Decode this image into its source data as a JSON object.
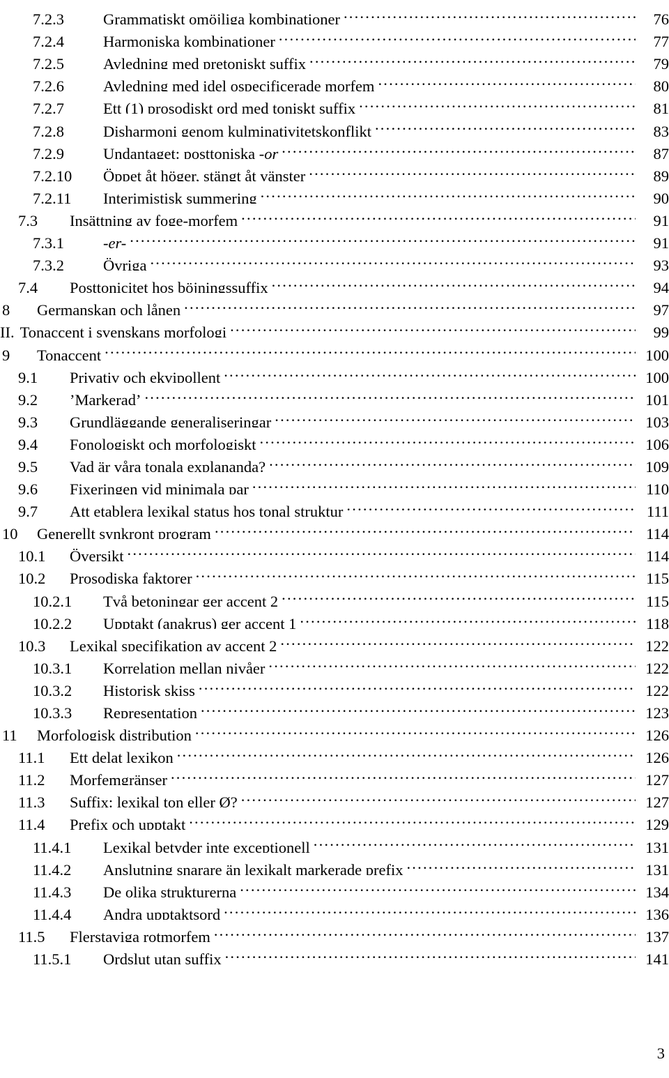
{
  "document": {
    "footer_page_number": "3"
  },
  "toc": {
    "entries": [
      {
        "number": "7.2.3",
        "title": "Grammatiskt omöjliga kombinationer",
        "page": "76",
        "level": 3
      },
      {
        "number": "7.2.4",
        "title": "Harmoniska kombinationer",
        "page": "77",
        "level": 3
      },
      {
        "number": "7.2.5",
        "title": "Avledning med pretoniskt suffix",
        "page": "79",
        "level": 3
      },
      {
        "number": "7.2.6",
        "title": "Avledning med idel ospecificerade morfem",
        "page": "80",
        "level": 3
      },
      {
        "number": "7.2.7",
        "title": "Ett (1) prosodiskt ord med toniskt suffix",
        "page": "81",
        "level": 3
      },
      {
        "number": "7.2.8",
        "title": "Disharmoni genom kulminativitetskonflikt",
        "page": "83",
        "level": 3
      },
      {
        "number": "7.2.9",
        "title": "Undantaget: posttoniska -or",
        "page": "87",
        "level": 3,
        "italic_tail": "-or",
        "title_head": "Undantaget: posttoniska "
      },
      {
        "number": "7.2.10",
        "title": "Öppet åt höger, stängt åt vänster",
        "page": "89",
        "level": 3
      },
      {
        "number": "7.2.11",
        "title": "Interimistisk summering",
        "page": "90",
        "level": 3
      },
      {
        "number": "7.3",
        "title": "Insättning av foge-morfem",
        "page": "91",
        "level": 2
      },
      {
        "number": "7.3.1",
        "title": "-er-",
        "page": "91",
        "level": 3,
        "italic_tail": "-er-",
        "title_head": ""
      },
      {
        "number": "7.3.2",
        "title": "Övriga",
        "page": "93",
        "level": 3
      },
      {
        "number": "7.4",
        "title": "Posttonicitet hos böjningssuffix",
        "page": "94",
        "level": 2
      },
      {
        "number": "8",
        "title": "Germanskan och lånen",
        "page": "97",
        "level": 1
      },
      {
        "number": "II.",
        "title": "Tonaccent i svenskans morfologi",
        "page": "99",
        "level": 0
      },
      {
        "number": "9",
        "title": "Tonaccent",
        "page": "100",
        "level": 1
      },
      {
        "number": "9.1",
        "title": "Privativ och ekvipollent",
        "page": "100",
        "level": 2
      },
      {
        "number": "9.2",
        "title": "’Markerad’",
        "page": "101",
        "level": 2
      },
      {
        "number": "9.3",
        "title": "Grundläggande generaliseringar",
        "page": "103",
        "level": 2
      },
      {
        "number": "9.4",
        "title": "Fonologiskt och morfologiskt",
        "page": "106",
        "level": 2
      },
      {
        "number": "9.5",
        "title": "Vad är våra tonala explananda?",
        "page": "109",
        "level": 2
      },
      {
        "number": "9.6",
        "title": "Fixeringen vid minimala par",
        "page": "110",
        "level": 2
      },
      {
        "number": "9.7",
        "title": "Att etablera lexikal status hos tonal struktur",
        "page": "111",
        "level": 2
      },
      {
        "number": "10",
        "title": "Generellt synkront program",
        "page": "114",
        "level": 1
      },
      {
        "number": "10.1",
        "title": "Översikt",
        "page": "114",
        "level": 2
      },
      {
        "number": "10.2",
        "title": "Prosodiska faktorer",
        "page": "115",
        "level": 2
      },
      {
        "number": "10.2.1",
        "title": "Två betoningar ger accent 2",
        "page": "115",
        "level": 3
      },
      {
        "number": "10.2.2",
        "title": "Upptakt (anakrus) ger accent 1",
        "page": "118",
        "level": 3
      },
      {
        "number": "10.3",
        "title": "Lexikal specifikation av accent 2",
        "page": "122",
        "level": 2
      },
      {
        "number": "10.3.1",
        "title": "Korrelation mellan nivåer",
        "page": "122",
        "level": 3
      },
      {
        "number": "10.3.2",
        "title": "Historisk skiss",
        "page": "122",
        "level": 3
      },
      {
        "number": "10.3.3",
        "title": "Representation",
        "page": "123",
        "level": 3
      },
      {
        "number": "11",
        "title": "Morfologisk distribution",
        "page": "126",
        "level": 1
      },
      {
        "number": "11.1",
        "title": "Ett delat lexikon",
        "page": "126",
        "level": 2
      },
      {
        "number": "11.2",
        "title": "Morfemgränser",
        "page": "127",
        "level": 2
      },
      {
        "number": "11.3",
        "title": "Suffix: lexikal ton eller Ø?",
        "page": "127",
        "level": 2
      },
      {
        "number": "11.4",
        "title": "Prefix och upptakt",
        "page": "129",
        "level": 2
      },
      {
        "number": "11.4.1",
        "title": "Lexikal betyder inte exceptionell",
        "page": "131",
        "level": 3
      },
      {
        "number": "11.4.2",
        "title": "Anslutning snarare än lexikalt markerade prefix",
        "page": "131",
        "level": 3
      },
      {
        "number": "11.4.3",
        "title": "De olika strukturerna",
        "page": "134",
        "level": 3
      },
      {
        "number": "11.4.4",
        "title": "Andra upptaktsord",
        "page": "136",
        "level": 3
      },
      {
        "number": "11.5",
        "title": "Flerstaviga rotmorfem",
        "page": "137",
        "level": 2
      },
      {
        "number": "11.5.1",
        "title": "Ordslut utan suffix",
        "page": "141",
        "level": 3
      }
    ]
  }
}
